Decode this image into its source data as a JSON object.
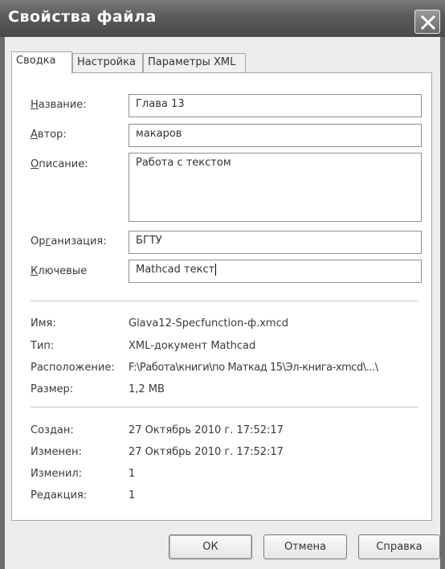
{
  "window": {
    "title": "Свойства файла"
  },
  "tabs": [
    "Сводка",
    "Настройка",
    "Параметры XML"
  ],
  "form": {
    "title_label_u": "Н",
    "title_label_rest": "азвание:",
    "title_value": "Глава 13",
    "author_label_u": "А",
    "author_label_rest": "втор:",
    "author_value": "макаров",
    "description_label_u": "О",
    "description_label_rest": "писание:",
    "description_value": "Работа с текстом",
    "org_label_pre": "Ор",
    "org_label_u": "г",
    "org_label_rest": "анизация:",
    "org_value": "БГТУ",
    "keywords_label_u": "К",
    "keywords_label_rest": "лючевые",
    "keywords_value": "Mathcad текст"
  },
  "file_info": [
    {
      "label": "Имя:",
      "value": "Glava12-Specfunction-ф.xmcd"
    },
    {
      "label": "Тип:",
      "value": "XML-документ Mathcad"
    },
    {
      "label": "Расположение:",
      "value": "F:\\Работа\\книги\\по Маткад 15\\Эл-книга-xmcd\\...\\"
    },
    {
      "label": "Размер:",
      "value": "1,2 MB"
    }
  ],
  "history": [
    {
      "label": "Создан:",
      "value": "27 Октябрь 2010 г. 17:52:17"
    },
    {
      "label": "Изменен:",
      "value": "27 Октябрь 2010 г. 17:52:17"
    },
    {
      "label": "Изменил:",
      "value": "1"
    },
    {
      "label": "Редакция:",
      "value": "1"
    }
  ],
  "buttons": {
    "ok": "ОК",
    "cancel": "Отмена",
    "help": "Справка"
  },
  "icons": {
    "close": "close-icon"
  }
}
